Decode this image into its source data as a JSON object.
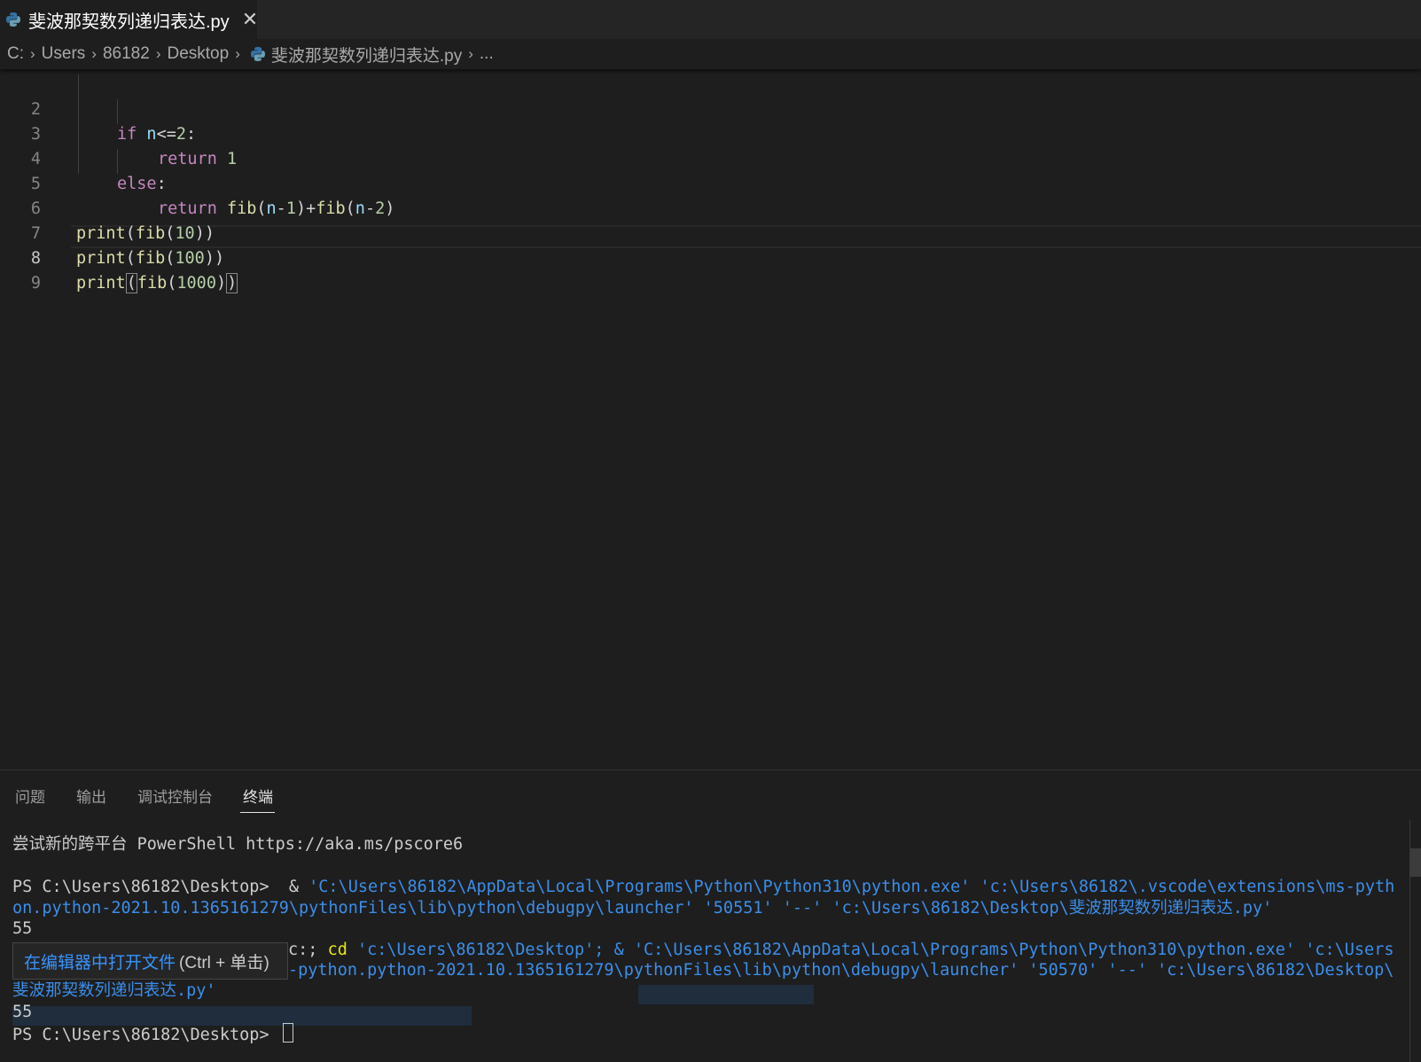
{
  "tab": {
    "label": "斐波那契数列递归表达.py",
    "close": "✕"
  },
  "breadcrumb": {
    "items": [
      "C:",
      "Users",
      "86182",
      "Desktop",
      "斐波那契数列递归表达.py",
      "..."
    ]
  },
  "editor": {
    "line_numbers": [
      "2",
      "3",
      "4",
      "5",
      "6",
      "7",
      "8",
      "9"
    ],
    "code": {
      "l2": {
        "kw": "if",
        "var": "n",
        "op": "<=",
        "num": "2",
        "colon": ":"
      },
      "l3": {
        "kw": "return",
        "num": "1"
      },
      "l4": {
        "kw": "else",
        "colon": ":"
      },
      "l5": {
        "kw": "return",
        "fn1": "fib",
        "p1": "(",
        "v1": "n",
        "op1": "-",
        "n1": "1",
        "p2": ")+",
        "fn2": "fib",
        "p3": "(",
        "v2": "n",
        "op2": "-",
        "n2": "2",
        "p4": ")"
      },
      "l6": {
        "fn": "print",
        "p1": "(",
        "fn2": "fib",
        "p2": "(",
        "num": "10",
        "p3": "))"
      },
      "l7": {
        "fn": "print",
        "p1": "(",
        "fn2": "fib",
        "p2": "(",
        "num": "100",
        "p3": "))"
      },
      "l8": {
        "fn": "print",
        "p1": "(",
        "fn2": "fib",
        "p2": "(",
        "num": "1000",
        "p3": ")",
        "p4": ")"
      }
    }
  },
  "panel": {
    "tabs": [
      "问题",
      "输出",
      "调试控制台",
      "终端"
    ],
    "terminal": {
      "line1": "尝试新的跨平台 PowerShell https://aka.ms/pscore6",
      "prompt1": "PS C:\\Users\\86182\\Desktop>  & ",
      "cmd1a": "'C:\\Users\\86182\\AppData\\Local\\Programs\\Python\\Python310\\python.exe' 'c:\\Users\\86182\\.vscode\\extensions\\ms-pyth",
      "cmd1b": "on.python-2021.10.1365161279\\pythonFiles\\lib\\python\\debugpy\\launcher' '50551' '--' 'c:\\Users\\86182\\Desktop\\斐波那契数列递归表达.py'",
      "out1": "55",
      "cmd2_prefix": "c:; ",
      "cmd2_cd": "cd",
      "cmd2_rest_a": " 'c:\\Users\\86182\\Desktop'; & 'C:\\Users\\86182\\AppData\\Local\\Programs\\Python\\Python310\\python.exe' 'c:\\Users",
      "cmd2b": "-python.python-2021.10.1365161279\\pythonFiles\\lib\\python\\debugpy\\launcher' '50570' '--' 'c:\\Users\\86182\\Desktop\\",
      "cmd2c": "斐波那契数列递归表达.py'",
      "out2": "55",
      "prompt2": "PS C:\\Users\\86182\\Desktop> "
    },
    "tooltip": {
      "link": "在编辑器中打开文件",
      "hint": "(Ctrl + 单击)"
    }
  },
  "colors": {
    "background": "#1e1e1e",
    "keyword": "#c586c0",
    "function": "#dcdcaa",
    "variable": "#9cdcfe",
    "number": "#b5cea8",
    "terminal_link": "#3b8eea",
    "terminal_cd": "#e5e510"
  },
  "icons": {
    "python": "python-file-icon",
    "close": "close-icon",
    "chevron": "chevron-right-icon"
  }
}
